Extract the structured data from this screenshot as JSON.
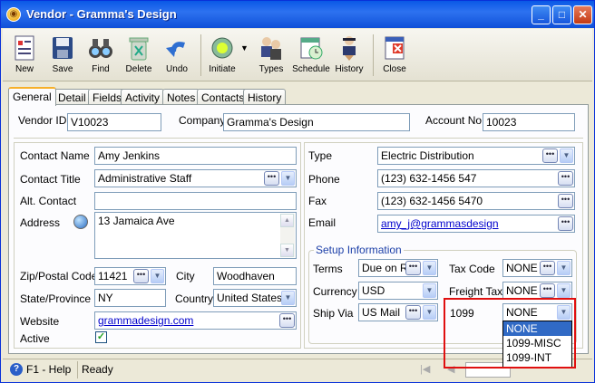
{
  "window": {
    "title": "Vendor - Gramma's Design"
  },
  "toolbar": {
    "new": "New",
    "save": "Save",
    "find": "Find",
    "delete": "Delete",
    "undo": "Undo",
    "initiate": "Initiate",
    "types": "Types",
    "schedule": "Schedule",
    "history": "History",
    "close": "Close"
  },
  "tabs": [
    "General",
    "Detail",
    "Fields",
    "Activity",
    "Notes",
    "Contacts",
    "History"
  ],
  "header": {
    "vendor_id_label": "Vendor ID",
    "vendor_id": "V10023",
    "company_label": "Company",
    "company": "Gramma's Design",
    "account_label": "Account No",
    "account": "10023"
  },
  "contact": {
    "name_label": "Contact Name",
    "name": "Amy Jenkins",
    "title_label": "Contact Title",
    "title": "Administrative Staff",
    "alt_label": "Alt. Contact",
    "alt": "",
    "address_label": "Address",
    "address": "13 Jamaica Ave",
    "zip_label": "Zip/Postal Code",
    "zip": "11421",
    "city_label": "City",
    "city": "Woodhaven",
    "state_label": "State/Province",
    "state": "NY",
    "country_label": "Country",
    "country": "United States",
    "website_label": "Website",
    "website": "grammadesign.com",
    "active_label": "Active"
  },
  "right": {
    "type_label": "Type",
    "type": "Electric Distribution",
    "phone_label": "Phone",
    "phone": "(123) 632-1456 547",
    "fax_label": "Fax",
    "fax": "(123) 632-1456 5470",
    "email_label": "Email",
    "email": "amy_j@grammasdesign"
  },
  "setup": {
    "title": "Setup Information",
    "terms_label": "Terms",
    "terms": "Due on R",
    "taxcode_label": "Tax Code",
    "taxcode": "NONE",
    "currency_label": "Currency",
    "currency": "USD",
    "freight_label": "Freight Tax",
    "freight": "NONE",
    "shipvia_label": "Ship Via",
    "shipvia": "US Mail",
    "f1099_label": "1099",
    "f1099": "NONE",
    "options_1099": [
      "NONE",
      "1099-MISC",
      "1099-INT"
    ]
  },
  "status": {
    "help": "F1 - Help",
    "state": "Ready"
  }
}
